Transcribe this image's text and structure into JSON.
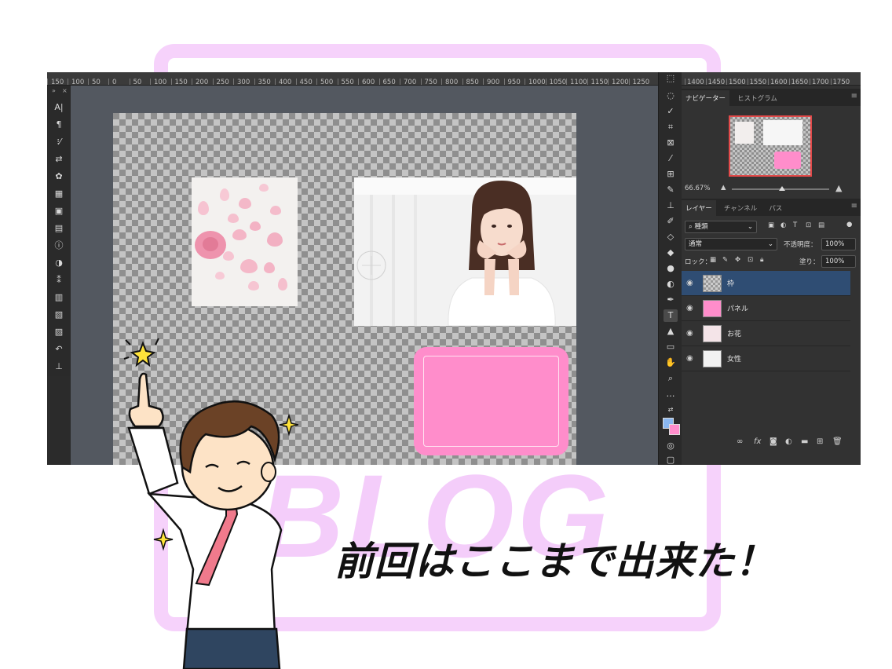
{
  "watermark": {
    "text": "BLOG"
  },
  "ruler": {
    "top_ticks": [
      "150",
      "100",
      "50",
      "0",
      "50",
      "100",
      "150",
      "200",
      "250",
      "300",
      "350",
      "400",
      "450",
      "500",
      "550",
      "600",
      "650",
      "700",
      "750",
      "800",
      "850",
      "900",
      "950",
      "1000",
      "1050",
      "1100",
      "1150",
      "1200",
      "1250"
    ],
    "right_ticks": [
      "1400",
      "1450",
      "1500",
      "1550",
      "1600",
      "1650",
      "1700",
      "1750"
    ]
  },
  "navigator": {
    "tabs": [
      "ナビゲーター",
      "ヒストグラム"
    ],
    "zoom": "66.67%"
  },
  "layers_panel": {
    "tabs": [
      "レイヤー",
      "チャンネル",
      "パス"
    ],
    "filter_kind": "種類",
    "blend_mode": "通常",
    "opacity_label": "不透明度：",
    "opacity_value": "100%",
    "lock_label": "ロック：",
    "fill_label": "塗り：",
    "fill_value": "100%",
    "layers": [
      {
        "name": "枠",
        "selected": true
      },
      {
        "name": "パネル",
        "selected": false
      },
      {
        "name": "お花",
        "selected": false
      },
      {
        "name": "女性",
        "selected": false
      }
    ]
  },
  "colors": {
    "foreground": "#8ab7f0",
    "background": "#ff8dcb",
    "panel_pink": "#ff8dcb",
    "watermark": "#f6d2fb"
  },
  "headline": "前回はここまで出来た！"
}
